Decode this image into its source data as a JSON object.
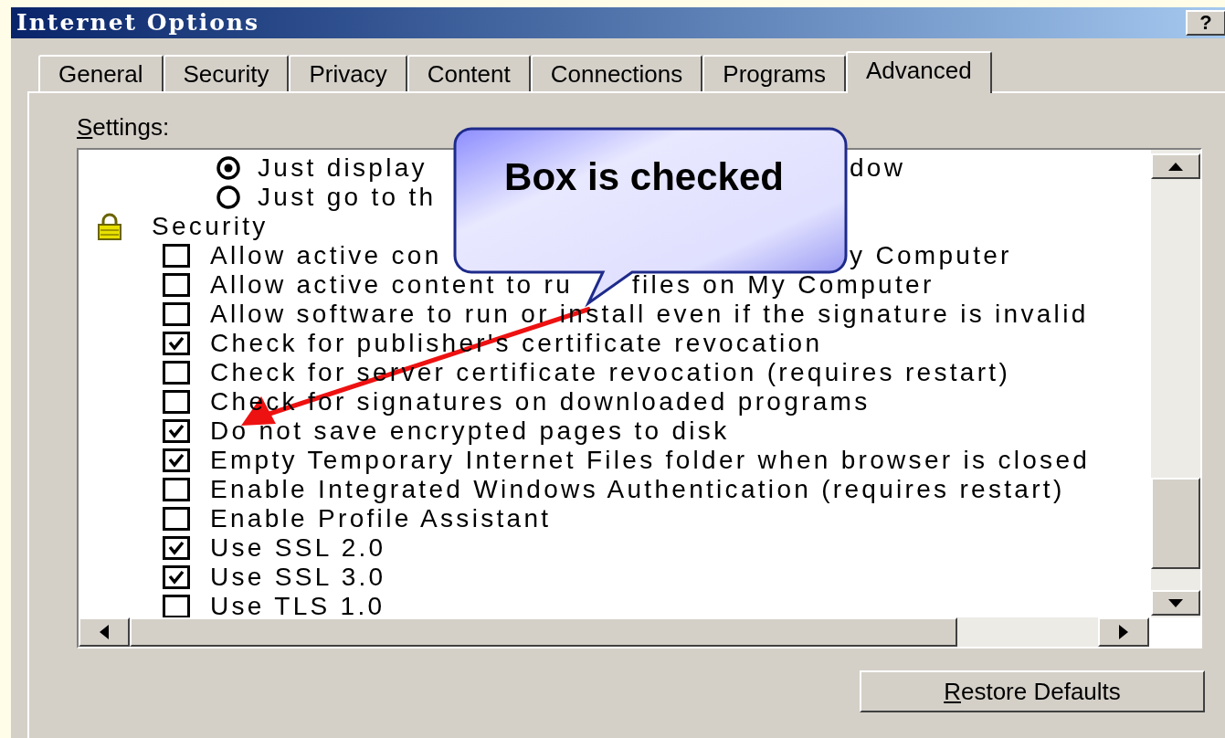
{
  "window": {
    "title": "Internet Options",
    "help_button": "?"
  },
  "tabs": [
    {
      "label": "General",
      "selected": false
    },
    {
      "label": "Security",
      "selected": false
    },
    {
      "label": "Privacy",
      "selected": false
    },
    {
      "label": "Content",
      "selected": false
    },
    {
      "label": "Connections",
      "selected": false
    },
    {
      "label": "Programs",
      "selected": false
    },
    {
      "label": "Advanced",
      "selected": true
    }
  ],
  "settings_label": "Settings:",
  "settings": [
    {
      "kind": "radio",
      "text": "Just display",
      "text_after": "dow",
      "selected": true
    },
    {
      "kind": "radio",
      "text": "Just go to th",
      "selected": false
    },
    {
      "kind": "group",
      "text": "Security"
    },
    {
      "kind": "checkbox",
      "text": "Allow active con",
      "text_after": "y Computer",
      "checked": false
    },
    {
      "kind": "checkbox",
      "text": "Allow active content to ru",
      "text_after": "files on My Computer",
      "checked": false
    },
    {
      "kind": "checkbox",
      "text": "Allow software to run or install even if the signature is invalid",
      "checked": false
    },
    {
      "kind": "checkbox",
      "text": "Check for publisher's certificate revocation",
      "checked": true
    },
    {
      "kind": "checkbox",
      "text": "Check for server certificate revocation (requires restart)",
      "checked": false
    },
    {
      "kind": "checkbox",
      "text": "Check for signatures on downloaded programs",
      "checked": false
    },
    {
      "kind": "checkbox",
      "text": "Do not save encrypted pages to disk",
      "checked": true
    },
    {
      "kind": "checkbox",
      "text": "Empty Temporary Internet Files folder when browser is closed",
      "checked": true
    },
    {
      "kind": "checkbox",
      "text": "Enable Integrated Windows Authentication (requires restart)",
      "checked": false
    },
    {
      "kind": "checkbox",
      "text": "Enable Profile Assistant",
      "checked": false
    },
    {
      "kind": "checkbox",
      "text": "Use SSL 2.0",
      "checked": true
    },
    {
      "kind": "checkbox",
      "text": "Use SSL 3.0",
      "checked": true
    },
    {
      "kind": "checkbox",
      "text": "Use TLS 1.0",
      "checked": false
    }
  ],
  "restore_button": "Restore Defaults",
  "callout": {
    "text": "Box is checked"
  }
}
